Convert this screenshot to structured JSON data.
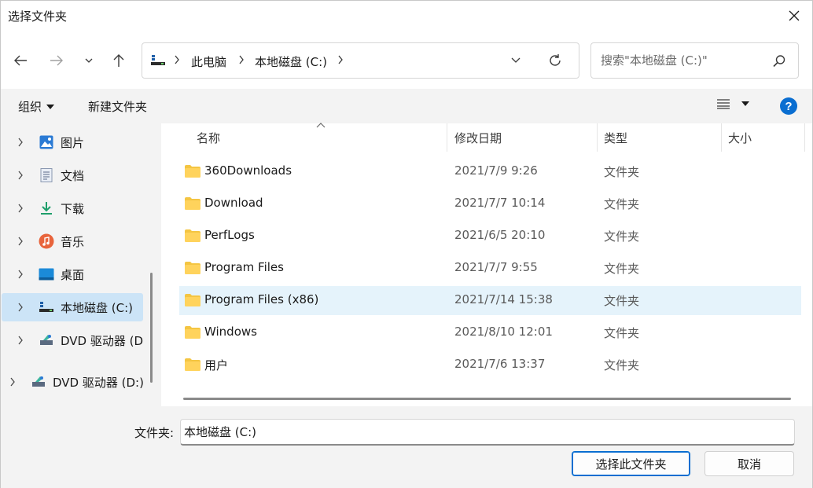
{
  "window": {
    "title": "选择文件夹"
  },
  "address": {
    "segments": [
      "此电脑",
      "本地磁盘 (C:)"
    ]
  },
  "search": {
    "placeholder": "搜索\"本地磁盘 (C:)\""
  },
  "commandbar": {
    "organize": "组织",
    "new_folder": "新建文件夹",
    "help": "?"
  },
  "sidebar": {
    "items": [
      {
        "label": "图片",
        "icon": "pictures-icon"
      },
      {
        "label": "文档",
        "icon": "documents-icon"
      },
      {
        "label": "下载",
        "icon": "download-icon"
      },
      {
        "label": "音乐",
        "icon": "music-icon"
      },
      {
        "label": "桌面",
        "icon": "desktop-icon"
      },
      {
        "label": "本地磁盘 (C:)",
        "icon": "drive-icon",
        "selected": true
      },
      {
        "label": "DVD 驱动器 (D",
        "icon": "dvd-icon"
      },
      {
        "label": "DVD 驱动器 (D:)",
        "icon": "dvd-icon"
      }
    ]
  },
  "columns": {
    "name": "名称",
    "date": "修改日期",
    "type": "类型",
    "size": "大小"
  },
  "files": [
    {
      "name": "360Downloads",
      "date": "2021/7/9 9:26",
      "type": "文件夹"
    },
    {
      "name": "Download",
      "date": "2021/7/7 10:14",
      "type": "文件夹"
    },
    {
      "name": "PerfLogs",
      "date": "2021/6/5 20:10",
      "type": "文件夹"
    },
    {
      "name": "Program Files",
      "date": "2021/7/7 9:55",
      "type": "文件夹"
    },
    {
      "name": "Program Files (x86)",
      "date": "2021/7/14 15:38",
      "type": "文件夹",
      "selected": true
    },
    {
      "name": "Windows",
      "date": "2021/8/10 12:01",
      "type": "文件夹"
    },
    {
      "name": "用户",
      "date": "2021/7/6 13:37",
      "type": "文件夹"
    }
  ],
  "footer": {
    "folder_label": "文件夹:",
    "folder_value": "本地磁盘 (C:)",
    "select_button": "选择此文件夹",
    "cancel_button": "取消"
  },
  "colors": {
    "accent": "#0a6ed1",
    "selection": "#cce4f7",
    "row_selection": "#e5f3fb",
    "folder": "#f4c542"
  }
}
